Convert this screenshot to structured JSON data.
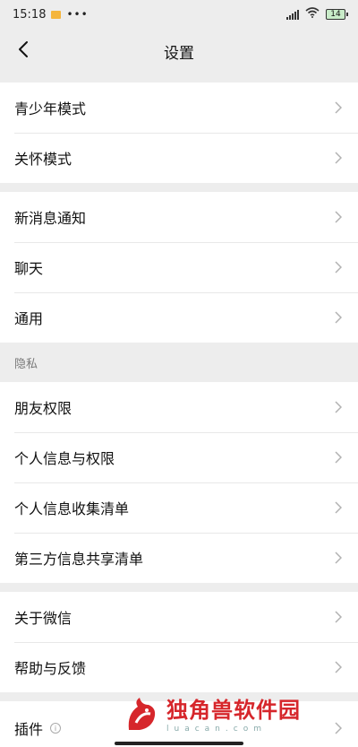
{
  "status_bar": {
    "time": "15:18",
    "dots": "•••",
    "battery": "14"
  },
  "nav": {
    "title": "设置"
  },
  "sections": {
    "group1": [
      "青少年模式",
      "关怀模式"
    ],
    "group2": [
      "新消息通知",
      "聊天",
      "通用"
    ],
    "privacy_label": "隐私",
    "group3": [
      "朋友权限",
      "个人信息与权限",
      "个人信息收集清单",
      "第三方信息共享清单"
    ],
    "group4": [
      "关于微信",
      "帮助与反馈"
    ],
    "group5": [
      "插件"
    ]
  },
  "watermark": {
    "name": "独角兽软件园",
    "domain": "luacan.com"
  },
  "colors": {
    "background": "#ededed",
    "accent_watermark": "#d6262b",
    "chevron": "#b2b2b2"
  },
  "icons": {
    "back": "chevron-left-icon",
    "row_arrow": "chevron-right-icon"
  }
}
